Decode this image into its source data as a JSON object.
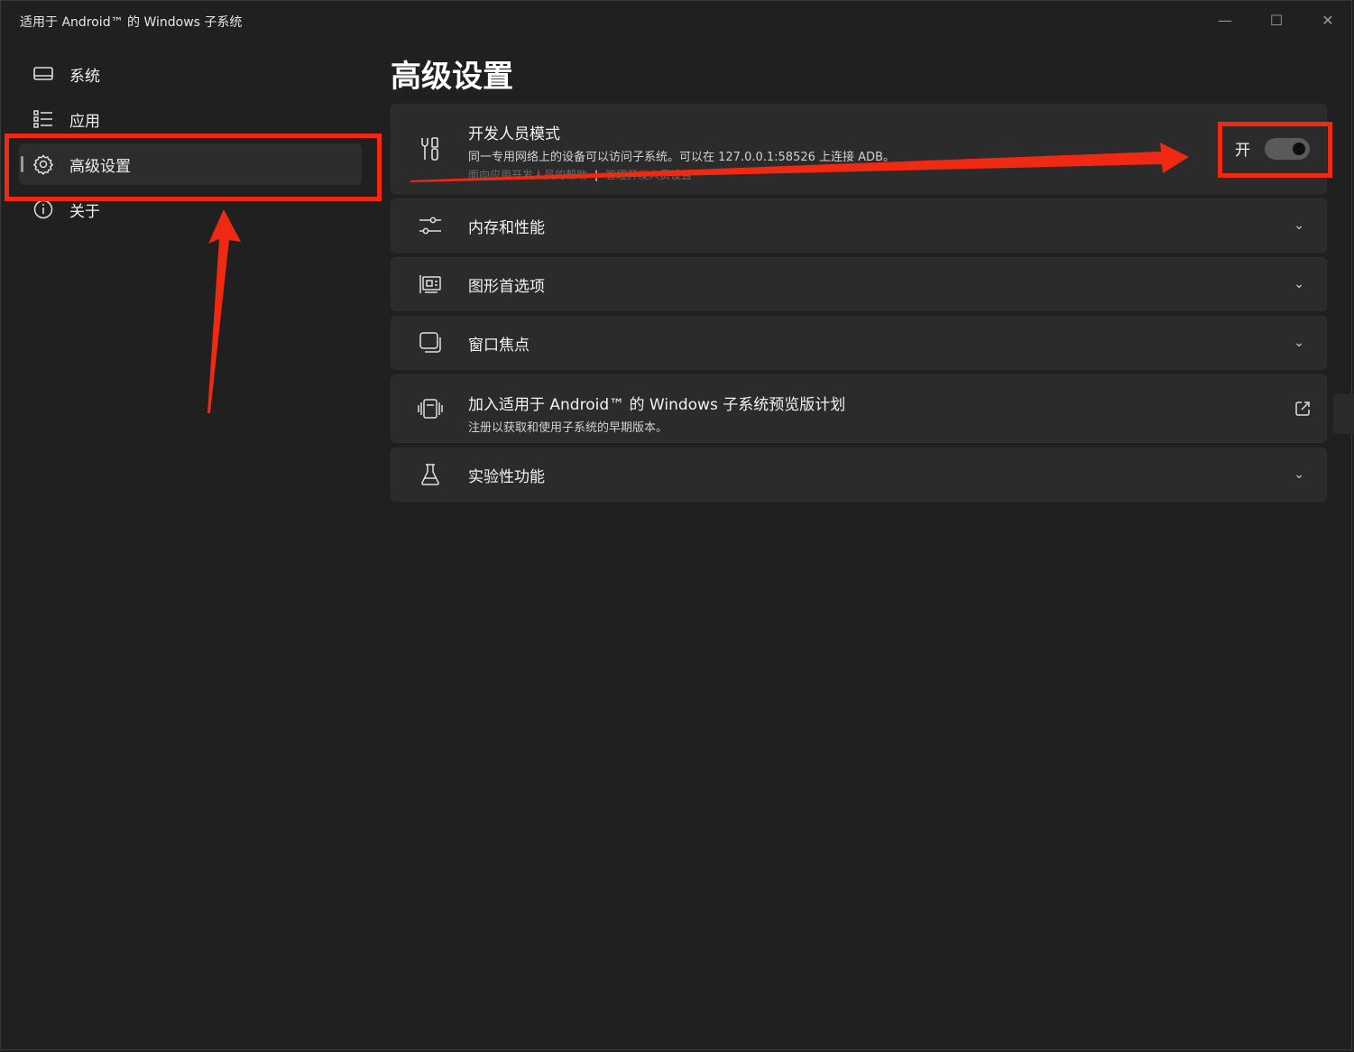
{
  "window": {
    "title": "适用于 Android™ 的 Windows 子系统",
    "controls": {
      "minimize": "—",
      "maximize": "☐",
      "close": "✕"
    }
  },
  "sidebar": {
    "items": [
      {
        "label": "系统",
        "icon": "monitor-icon",
        "active": false
      },
      {
        "label": "应用",
        "icon": "list-icon",
        "active": false
      },
      {
        "label": "高级设置",
        "icon": "gear-icon",
        "active": true
      },
      {
        "label": "关于",
        "icon": "info-icon",
        "active": false
      }
    ]
  },
  "page": {
    "title": "高级设置"
  },
  "developer_mode": {
    "title": "开发人员模式",
    "description": "同一专用网络上的设备可以访问子系统。可以在 127.0.0.1:58526 上连接 ADB。",
    "link_help": "面向应用开发人员的帮助",
    "link_separator": "|",
    "link_manage": "管理开发人员设置",
    "toggle_label": "开",
    "toggle_on": true,
    "icon": "tools-icon"
  },
  "settings": [
    {
      "title": "内存和性能",
      "icon": "sliders-icon"
    },
    {
      "title": "图形首选项",
      "icon": "gpu-icon"
    },
    {
      "title": "窗口焦点",
      "icon": "window-focus-icon"
    }
  ],
  "preview_program": {
    "title": "加入适用于 Android™ 的 Windows 子系统预览版计划",
    "subtitle": "注册以获取和使用子系统的早期版本。",
    "icon": "preview-icon",
    "action_icon": "open-external-icon"
  },
  "experimental": {
    "title": "实验性功能",
    "icon": "flask-icon"
  },
  "chevron": "⌄",
  "annotation_color": "#f02a12"
}
